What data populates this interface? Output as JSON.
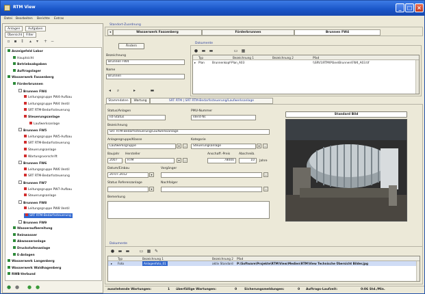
{
  "window": {
    "title": "RTM View",
    "buttons": {
      "minimize": "_",
      "maximize": "□",
      "close": "×"
    }
  },
  "menu": [
    "Datei",
    "Bearbeiten",
    "Berichte",
    "Extras"
  ],
  "left_panel": {
    "tabs": [
      "Anlagen",
      "Aufgaben"
    ],
    "subtabs": [
      "Übersicht",
      "Filter"
    ],
    "tree": [
      {
        "label": "Anzeigefeld Labor",
        "level": 0,
        "bold": true
      },
      {
        "label": "Hauptsicht",
        "level": 1,
        "bold": false
      },
      {
        "label": "Betriebsabgaben",
        "level": 1,
        "bold": true
      },
      {
        "label": "Auftragslager",
        "level": 1,
        "bold": true
      },
      {
        "label": "Wasserwerk Fassenberg",
        "level": 0,
        "bold": true
      },
      {
        "label": "Förderbrunnen",
        "level": 1,
        "bold": true
      },
      {
        "label": "Brunnen FW4",
        "level": 2,
        "bold": true
      },
      {
        "label": "Leitungsgruppe PW4-Aufbau",
        "level": 3,
        "bold": false
      },
      {
        "label": "Leitungsgruppe PW4 Ventil",
        "level": 3,
        "bold": false
      },
      {
        "label": "SRT RTM-Bedarfssteuerung",
        "level": 3,
        "bold": false
      },
      {
        "label": "Steuerungsanlage",
        "level": 3,
        "bold": true
      },
      {
        "label": "Laufwerksanlage",
        "level": 4,
        "bold": false
      },
      {
        "label": "Brunnen FW5",
        "level": 2,
        "bold": true
      },
      {
        "label": "Leitungsgruppe PW5-Aufbau",
        "level": 3,
        "bold": false
      },
      {
        "label": "SRT RTM-Bedarfssteuerung",
        "level": 3,
        "bold": false
      },
      {
        "label": "Steuerungsanlage",
        "level": 3,
        "bold": false
      },
      {
        "label": "Wartungsvorschrift",
        "level": 3,
        "bold": false
      },
      {
        "label": "Brunnen FW6",
        "level": 2,
        "bold": true
      },
      {
        "label": "Leitungsgruppe PW6 Ventil",
        "level": 3,
        "bold": false
      },
      {
        "label": "SRT RTM-Bedarfssteuerung",
        "level": 3,
        "bold": false
      },
      {
        "label": "Brunnen FW7",
        "level": 2,
        "bold": true
      },
      {
        "label": "Leitungsgruppe PW7-Aufbau",
        "level": 3,
        "bold": false
      },
      {
        "label": "Steuerungsanlage",
        "level": 3,
        "bold": false
      },
      {
        "label": "Brunnen FW8",
        "level": 2,
        "bold": true
      },
      {
        "label": "Leitungsgruppe PW8 Ventil",
        "level": 3,
        "bold": false
      },
      {
        "label": "SRT RTM-Bedarfssteuerung",
        "level": 3,
        "bold": false,
        "selected": true
      },
      {
        "label": "Brunnen FW9",
        "level": 2,
        "bold": true
      },
      {
        "label": "Wasseraufbereitung",
        "level": 1,
        "bold": true
      },
      {
        "label": "Reinwasser",
        "level": 1,
        "bold": true
      },
      {
        "label": "Abwasseranlage",
        "level": 1,
        "bold": true
      },
      {
        "label": "Druckstufenanlage",
        "level": 1,
        "bold": true
      },
      {
        "label": "E-Anlagen",
        "level": 1,
        "bold": true
      },
      {
        "label": "Wasserwerk Langenberg",
        "level": 0,
        "bold": true
      },
      {
        "label": "Wasserwerk Waldhagenberg",
        "level": 0,
        "bold": true
      },
      {
        "label": "RWB-Verbund",
        "level": 0,
        "bold": true
      }
    ]
  },
  "location_group": {
    "label": "Standort-Zuordnung",
    "tabs": [
      "Wasserwerk Fassenberg",
      "Förderbrunnen",
      "Brunnen FW4"
    ]
  },
  "top_form": {
    "change_button": "Ändern",
    "bezeichnung_label": "Bezeichnung",
    "bezeichnung_value": "Brunnen FW4",
    "name_label": "Name",
    "name_value": "Brunnen"
  },
  "documents_top": {
    "label": "Dokumente",
    "headers": [
      "Typ",
      "Bezeichnung 1",
      "Bezeichnung 2",
      "Pfad"
    ],
    "rows": [
      {
        "typ": "Plan",
        "bez1": "Brunnenkopf-Plan_A03",
        "bez2": "",
        "pfad": "\\\\SRV1\\RTM\\Pläne\\Brunnen\\FW4_A03.tif"
      }
    ]
  },
  "detail_tabs": [
    "Stammdaten",
    "Wartung",
    "SRT RTM | SRT RTM-Bedarfssteuerung/Laufwerksanlage"
  ],
  "detail_form": {
    "status_label": "Status/Anlagen",
    "status_value": "Ist-Status",
    "pmu_label": "PMU-Nummer",
    "pmu_value": "Ident-Nr.",
    "bezeichnung_label": "Bezeichnung",
    "bezeichnung_value": "SRT RTM-Bedarfssteuerung/Laufwerksanlage",
    "gruppe_label": "Anlagengruppe/Klasse",
    "gruppe_value": "Laufwerksgruppe",
    "kategorie_label": "Kategorie",
    "kategorie_value": "Steuerungsanlage",
    "baujahr_label": "Baujahr",
    "baujahr_value": "2007",
    "hersteller_label": "Hersteller",
    "hersteller_value": "RTM",
    "anschaffung_label": "Anschaff.-Preis",
    "anschaffung_value": "78000",
    "abschreib_label": "Abschreib.",
    "abschreib_value": "10",
    "abschreib_unit": "Jahre",
    "datum_label": "Datum/Einbau",
    "datum_value": "20.07.2012",
    "vorgaenger_label": "Vorgänger",
    "vorgaenger_value": "",
    "status_ref_label": "Status Referenzanlage",
    "status_ref_value": "",
    "nachfolger_label": "Nachfolger",
    "nachfolger_value": "",
    "bemerkung_label": "Bemerkung",
    "bemerkung_value": ""
  },
  "photo": {
    "header": "Standard Bild"
  },
  "documents_bottom": {
    "label": "Dokumente",
    "headers": [
      "Typ",
      "Bezeichnung 1",
      "Bezeichnung 2",
      "Pfad"
    ],
    "rows": [
      {
        "typ": "Foto",
        "bez1": "Anlagenfoto_01",
        "bez2": "aktiv Standard",
        "pfad": "P:\\Software\\Projekte\\RTM\\View\\Medien\\RTM\\View Technische Übersicht Bilder.jpg"
      }
    ]
  },
  "status_bar": {
    "item1": "ausstehende Wartungen:",
    "value1": "1",
    "item2": "überfällige Wartungen:",
    "value2": "0",
    "item3": "Sicherungsmeldungen:",
    "value3": "0",
    "item4": "Auftrags-Laufzeit:",
    "value4": "0:06 Std./Min."
  },
  "colors": {
    "titlebar": "#1b57c9",
    "selection": "#3168d0",
    "red_marker": "#d12d2d"
  }
}
